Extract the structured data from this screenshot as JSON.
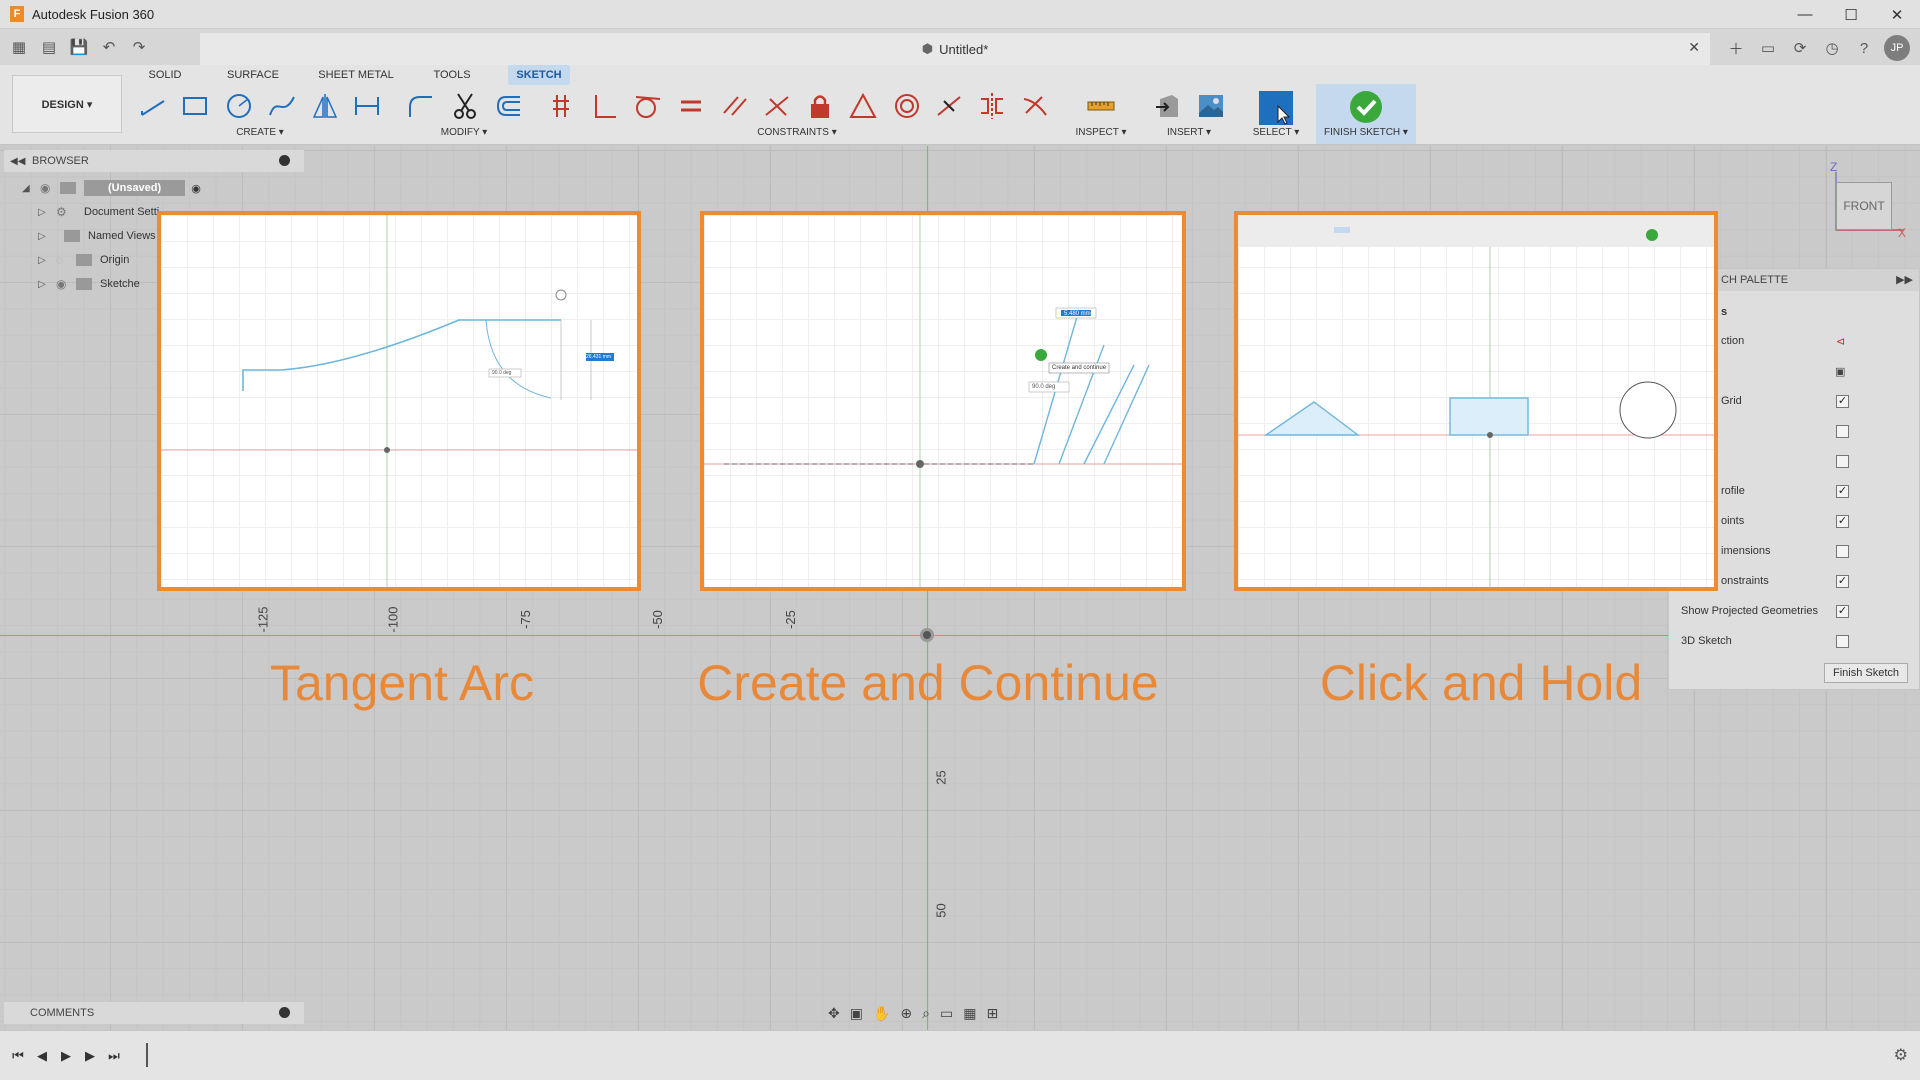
{
  "titlebar": {
    "app_logo": "F",
    "title": "Autodesk Fusion 360",
    "controls": [
      "—",
      "☐",
      "✕"
    ]
  },
  "document": {
    "title": "Untitled*",
    "close": "✕"
  },
  "user": {
    "initials": "JP"
  },
  "toolbar": {
    "workspace": "DESIGN ▾",
    "tabs": [
      "SOLID",
      "SURFACE",
      "SHEET METAL",
      "TOOLS",
      "SKETCH"
    ],
    "active_tab": "SKETCH",
    "groups": {
      "create": "CREATE ▾",
      "modify": "MODIFY ▾",
      "constraints": "CONSTRAINTS ▾",
      "inspect": "INSPECT ▾",
      "insert": "INSERT ▾",
      "select": "SELECT ▾",
      "finish": "FINISH SKETCH ▾"
    }
  },
  "browser": {
    "title": "BROWSER",
    "root": "(Unsaved)",
    "items": [
      "Document Setti",
      "Named Views",
      "Origin",
      "Sketche"
    ]
  },
  "comments": {
    "title": "COMMENTS"
  },
  "viewcube": {
    "face": "FRONT",
    "z": "Z",
    "x": "X"
  },
  "palette": {
    "title": "CH PALETTE",
    "section": "s",
    "rows": [
      {
        "label": "ction",
        "kind": "icon",
        "checked": null
      },
      {
        "label": "",
        "kind": "icon",
        "checked": null
      },
      {
        "label": "Grid",
        "kind": "check",
        "checked": true
      },
      {
        "label": "",
        "kind": "check",
        "checked": false
      },
      {
        "label": "",
        "kind": "check",
        "checked": false
      },
      {
        "label": "rofile",
        "kind": "check",
        "checked": true
      },
      {
        "label": "oints",
        "kind": "check",
        "checked": true
      },
      {
        "label": "imensions",
        "kind": "check",
        "checked": false
      },
      {
        "label": "onstraints",
        "kind": "check",
        "checked": true
      },
      {
        "label": "Show Projected Geometries",
        "kind": "check",
        "checked": true
      },
      {
        "label": "3D Sketch",
        "kind": "check",
        "checked": false
      }
    ],
    "finish_button": "Finish Sketch"
  },
  "axis_numbers": {
    "horizontal": [
      "-125",
      "-100",
      "-75",
      "-50",
      "-25"
    ],
    "vertical": [
      "25",
      "50"
    ]
  },
  "captions": [
    "Tangent Arc",
    "Create and Continue",
    "Click and Hold"
  ],
  "thumbnail_labels": {
    "tangent_arc": {
      "dim": "26.431 mm",
      "angle": "90.0 deg"
    },
    "create_continue": {
      "dim": "5.480 mm",
      "tooltip": "Create and continue",
      "angle": "90.0 deg"
    }
  },
  "colors": {
    "accent_orange": "#ee8a30",
    "sketch_blue": "#6fb6dc",
    "active_tab_bg": "#c5d9ee",
    "finish_green": "#3aa83a"
  }
}
